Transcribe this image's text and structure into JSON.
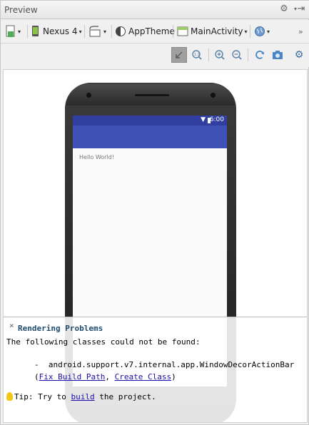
{
  "panel": {
    "title": "Preview"
  },
  "toolbar1": {
    "device_label": "Nexus 4",
    "theme_label": "AppTheme",
    "activity_label": "MainActivity",
    "overflow_label": "»"
  },
  "screen": {
    "status_time": "6:00",
    "hello_text": "Hello World!",
    "status_bar_color": "#303f9f",
    "app_bar_color": "#3f51b5"
  },
  "problems": {
    "close_glyph": "×",
    "title": "Rendering Problems",
    "line1": "The following classes could not be found:",
    "bullet": "-",
    "class_name": "android.support.v7.internal.app.WindowDecorActionBar",
    "open_paren": "(",
    "fix_link": "Fix Build Path",
    "comma": ", ",
    "create_link": "Create Class",
    "close_paren": ")",
    "tip_prefix": "Tip: Try to ",
    "tip_link": "build",
    "tip_suffix": " the project."
  }
}
